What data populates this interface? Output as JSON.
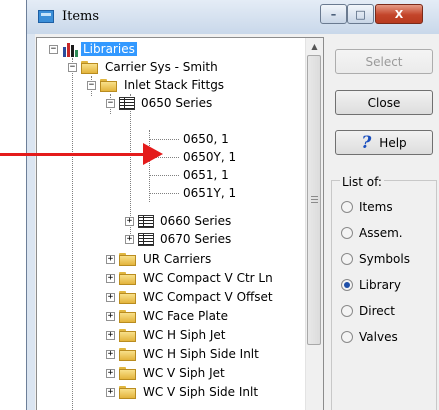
{
  "window": {
    "title": "Items",
    "minimize_glyph": "–",
    "maximize_glyph": "□",
    "close_glyph": "X"
  },
  "tree": {
    "expand_glyph": "+",
    "collapse_glyph": "−",
    "root": {
      "label": "Libraries",
      "icon": "library-icon",
      "state": "expanded",
      "selected": true
    },
    "carrier": {
      "label": "Carrier Sys - Smith",
      "icon": "folder-icon",
      "state": "expanded"
    },
    "inlet": {
      "label": "Inlet Stack Fittgs",
      "icon": "folder-icon",
      "state": "expanded"
    },
    "series_0650": {
      "label": "0650 Series",
      "icon": "series-icon",
      "state": "expanded"
    },
    "items_0650": [
      "0650, 1",
      "0650Y, 1",
      "0651, 1",
      "0651Y, 1"
    ],
    "series_0660": {
      "label": "0660 Series",
      "icon": "series-icon",
      "state": "collapsed"
    },
    "series_0670": {
      "label": "0670 Series",
      "icon": "series-icon",
      "state": "collapsed"
    },
    "folders": [
      "UR Carriers",
      "WC Compact V Ctr Ln",
      "WC Compact V Offset",
      "WC Face Plate",
      "WC H Siph Jet",
      "WC H Siph Side Inlt",
      "WC V Siph Jet",
      "WC V Siph Side Inlt"
    ]
  },
  "buttons": {
    "select": "Select",
    "close": "Close",
    "help": "Help",
    "help_glyph": "?"
  },
  "list_of": {
    "label": "List of:",
    "options": [
      "Items",
      "Assem.",
      "Symbols",
      "Library",
      "Direct",
      "Valves"
    ],
    "selected": "Library"
  },
  "annotation": {
    "color": "#e41b1b",
    "icon": "red-arrow-icon"
  },
  "colors": {
    "selection": "#3399ff",
    "folder": "#e3b43c",
    "title_bar": "#dbe5f1"
  }
}
